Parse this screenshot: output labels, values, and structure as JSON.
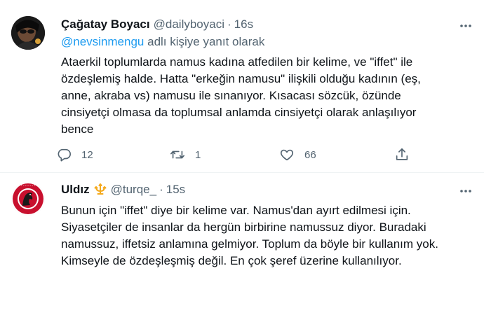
{
  "tweets": [
    {
      "author": {
        "name": "Çağatay Boyacı",
        "handle": "@dailyboyaci",
        "time": "16s"
      },
      "reply": {
        "mention": "@nevsinmengu",
        "suffix": " adlı kişiye yanıt olarak"
      },
      "lines": [
        "Ataerkil toplumlarda namus kadına atfedilen bir kelime, ve \"iffet\" ile",
        "özdeşlemiş halde. Hatta \"erkeğin namusu\" ilişkili olduğu kadının (eş,",
        "anne, akraba vs) namusu ile sınanıyor. Kısacası sözcük, özünde",
        "cinsiyetçi olmasa da toplumsal anlamda cinsiyetçi olarak anlaşılıyor",
        "bence"
      ],
      "actions": {
        "reply_count": "12",
        "retweet_count": "1",
        "like_count": "66"
      }
    },
    {
      "author": {
        "name": "Uldız",
        "handle": "@turqe_",
        "time": "15s"
      },
      "lines": [
        "Bunun için \"iffet\" diye bir kelime var. Namus'dan ayırt edilmesi için.",
        "Siyasetçiler de insanlar da hergün birbirine namussuz diyor. Buradaki",
        "namussuz, iffetsiz anlamına gelmiyor. Toplum da böyle bir kullanım yok.",
        "Kimseyle de özdeşleşmiş değil. En çok şeref üzerine kullanılıyor."
      ]
    }
  ],
  "dot": "·",
  "colors": {
    "accent": "#1d9bf0",
    "secondary_text": "#536471",
    "badge": "#f4a91c",
    "emblem_red": "#c8102e"
  },
  "icons": [
    "reply-icon",
    "retweet-icon",
    "like-icon",
    "share-icon",
    "more-icon",
    "trident-badge-icon"
  ]
}
